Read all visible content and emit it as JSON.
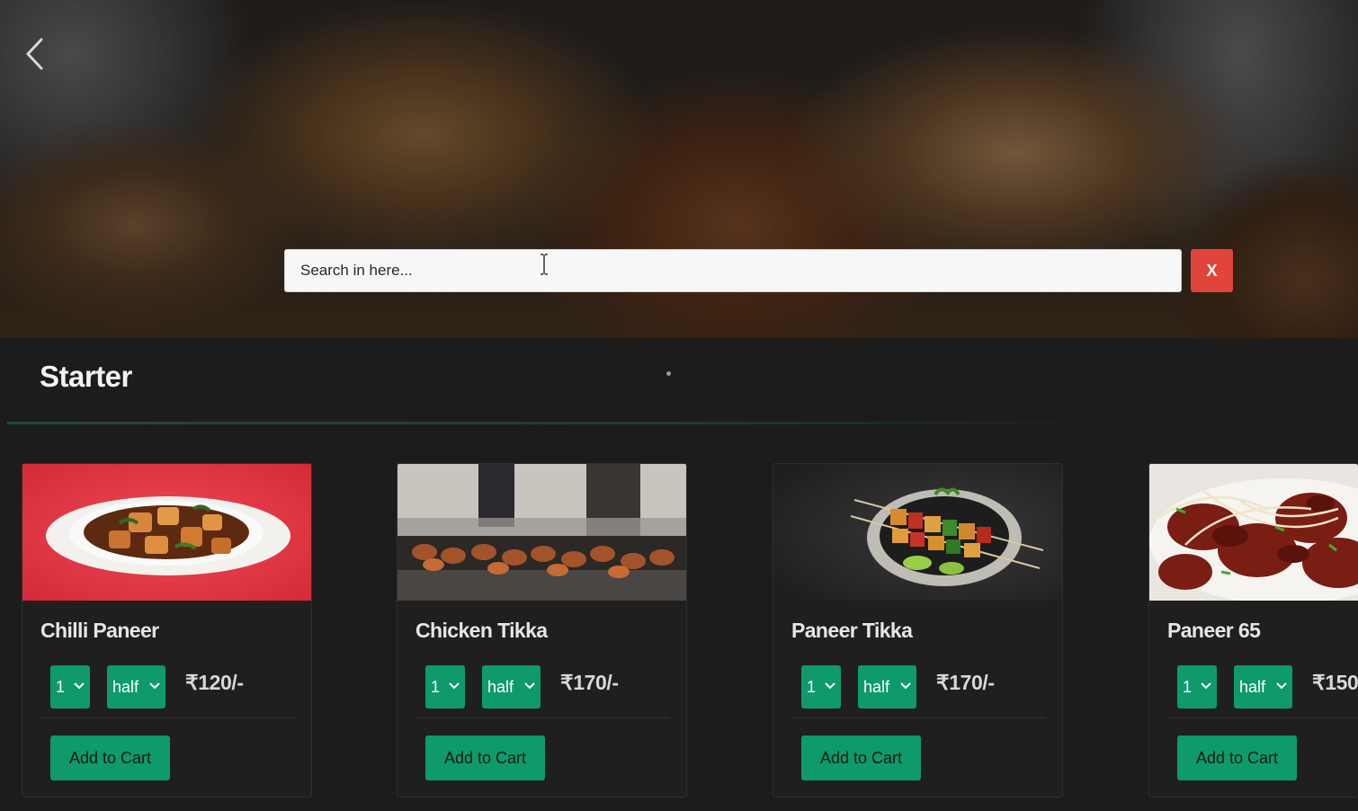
{
  "search": {
    "placeholder": "Search in here...",
    "clear_label": "X"
  },
  "section": {
    "title": "Starter"
  },
  "items": [
    {
      "name": "Chilli Paneer",
      "qty": "1",
      "size": "half",
      "price": "₹120/-",
      "add_label": "Add to Cart"
    },
    {
      "name": "Chicken Tikka",
      "qty": "1",
      "size": "half",
      "price": "₹170/-",
      "add_label": "Add to Cart"
    },
    {
      "name": "Paneer Tikka",
      "qty": "1",
      "size": "half",
      "price": "₹170/-",
      "add_label": "Add to Cart"
    },
    {
      "name": "Paneer 65",
      "qty": "1",
      "size": "half",
      "price": "₹150",
      "add_label": "Add to Cart"
    }
  ],
  "colors": {
    "accent": "#0e9a6a",
    "clear_button": "#e0453b",
    "background": "#1c1c1c"
  },
  "icons": {
    "back": "chevron-left-icon",
    "dropdown": "chevron-down-icon",
    "cursor": "text-cursor-icon"
  }
}
